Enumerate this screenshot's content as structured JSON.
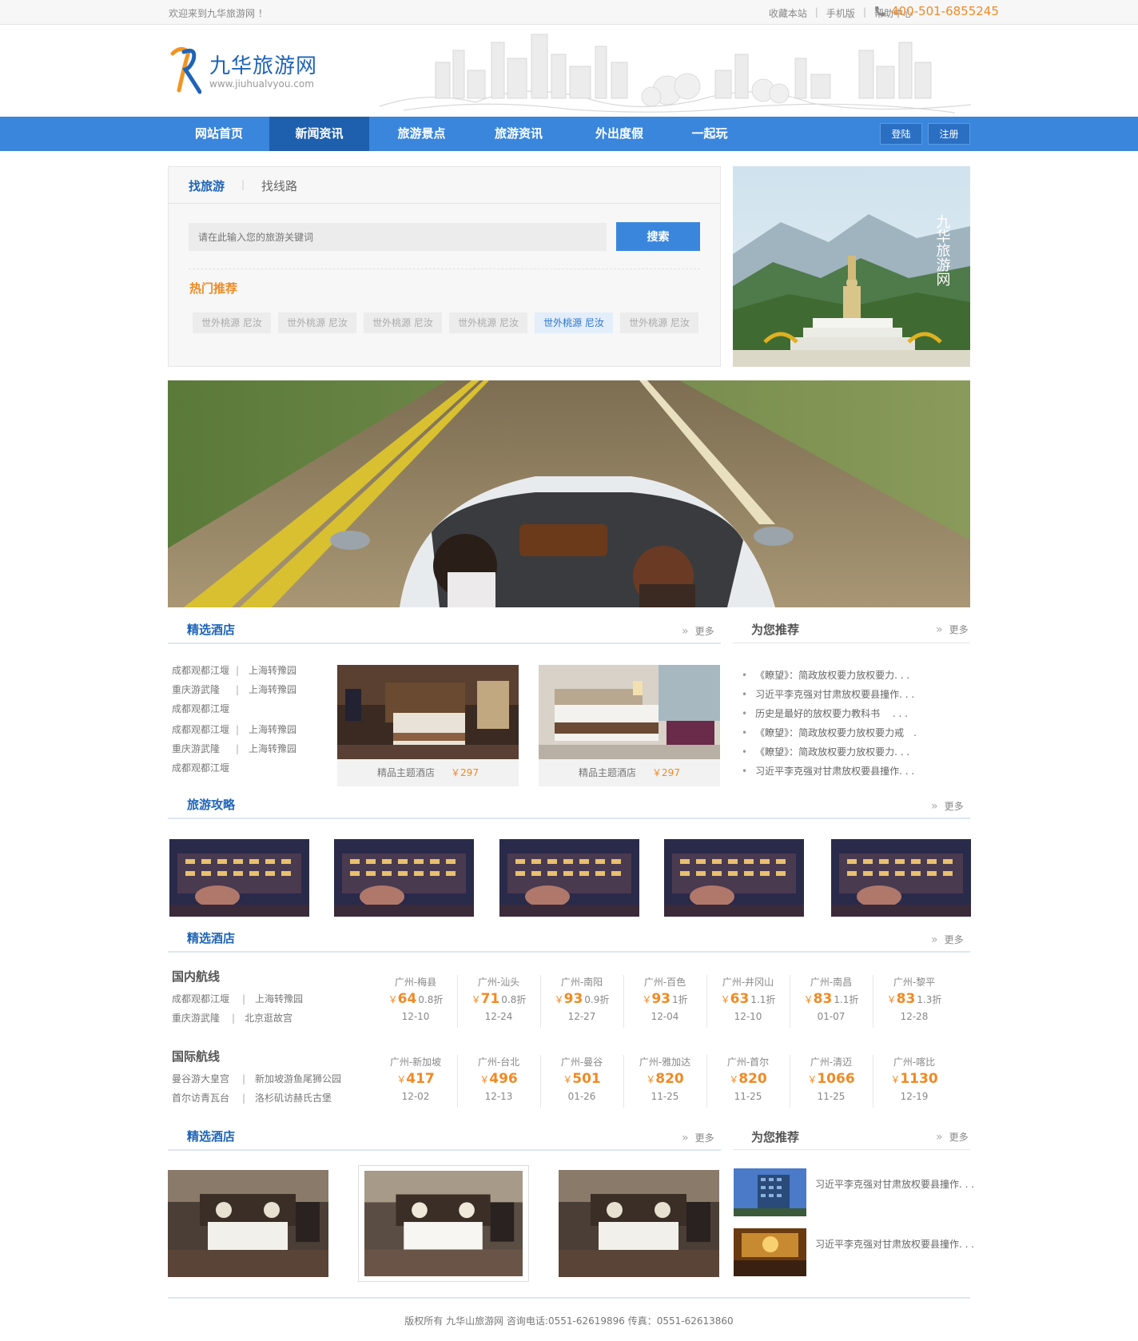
{
  "topbar": {
    "welcome": "欢迎来到九华旅游网 ！",
    "links": [
      "收藏本站",
      "手机版",
      "帮助中心"
    ],
    "phone": "400-501-6855245"
  },
  "logo": {
    "title": "九华旅游网",
    "url": "www.jiuhualvyou.com"
  },
  "nav": {
    "items": [
      "网站首页",
      "新闻资讯",
      "旅游景点",
      "旅游资讯",
      "外出度假",
      "一起玩"
    ],
    "active_index": 1,
    "login": "登陆",
    "register": "注册"
  },
  "search": {
    "tab_active": "找旅游",
    "tab_other": "找线路",
    "placeholder": "请在此输入您的旅游关键词",
    "button": "搜索",
    "hot_title": "热门推荐",
    "hot_tags": [
      "世外桃源 尼汝",
      "世外桃源 尼汝",
      "世外桃源 尼汝",
      "世外桃源 尼汝",
      "世外桃源 尼汝",
      "世外桃源 尼汝"
    ],
    "hot_active_index": 4
  },
  "side_photo": {
    "calligraphy": "九华旅游网"
  },
  "hotels": {
    "title": "精选酒店",
    "more": "更多",
    "list": [
      [
        "成都观都江堰",
        "上海转豫园"
      ],
      [
        "重庆游武隆",
        "上海转豫园"
      ],
      [
        "成都观都江堰",
        ""
      ],
      [
        "成都观都江堰",
        "上海转豫园"
      ],
      [
        "重庆游武隆",
        "上海转豫园"
      ],
      [
        "成都观都江堰",
        ""
      ]
    ],
    "cards": [
      {
        "name": "精品主题酒店",
        "price": "￥297"
      },
      {
        "name": "精品主题酒店",
        "price": "￥297"
      }
    ]
  },
  "recommend": {
    "title": "为您推荐",
    "more": "更多",
    "items": [
      "《瞭望》：简政放权要力放权要力. . .",
      "习近平李克强对甘肃放权要县撞作. . .",
      "历史是最好的放权要力教科书　 . . .",
      "《瞭望》：简政放权要力放权要力戒　.",
      "《瞭望》：简政放权要力放权要力. . .",
      "习近平李克强对甘肃放权要县撞作. . ."
    ]
  },
  "strategy": {
    "title": "旅游攻略",
    "more": "更多"
  },
  "routes": {
    "title": "精选酒店",
    "more": "更多",
    "domestic": {
      "title": "国内航线",
      "links": [
        [
          "成都观都江堰",
          "上海转豫园"
        ],
        [
          "重庆游武隆",
          "北京逛故宫"
        ]
      ],
      "items": [
        {
          "city": "广州-梅县",
          "price": "64",
          "disc": "0.8折",
          "date": "12-10"
        },
        {
          "city": "广州-汕头",
          "price": "71",
          "disc": "0.8折",
          "date": "12-24"
        },
        {
          "city": "广州-南阳",
          "price": "93",
          "disc": "0.9折",
          "date": "12-27"
        },
        {
          "city": "广州-百色",
          "price": "93",
          "disc": "1折",
          "date": "12-04"
        },
        {
          "city": "广州-井冈山",
          "price": "63",
          "disc": "1.1折",
          "date": "12-10"
        },
        {
          "city": "广州-南昌",
          "price": "83",
          "disc": "1.1折",
          "date": "01-07"
        },
        {
          "city": "广州-黎平",
          "price": "83",
          "disc": "1.3折",
          "date": "12-28"
        }
      ]
    },
    "international": {
      "title": "国际航线",
      "links": [
        [
          "曼谷游大皇宫",
          "新加坡游鱼尾狮公园"
        ],
        [
          "首尔访青瓦台",
          "洛杉矶访赫氏古堡"
        ]
      ],
      "items": [
        {
          "city": "广州-新加坡",
          "price": "417",
          "date": "12-02"
        },
        {
          "city": "广州-台北",
          "price": "496",
          "date": "12-13"
        },
        {
          "city": "广州-曼谷",
          "price": "501",
          "date": "01-26"
        },
        {
          "city": "广州-雅加达",
          "price": "820",
          "date": "11-25"
        },
        {
          "city": "广州-首尔",
          "price": "820",
          "date": "11-25"
        },
        {
          "city": "广州-清迈",
          "price": "1066",
          "date": "11-25"
        },
        {
          "city": "广州-喀比",
          "price": "1130",
          "date": "12-19"
        }
      ]
    },
    "currency": "￥"
  },
  "hotels2": {
    "title": "精选酒店",
    "more": "更多"
  },
  "recommend2": {
    "title": "为您推荐",
    "more": "更多",
    "items": [
      "习近平李克强对甘肃放权要县撞作. . .",
      "习近平李克强对甘肃放权要县撞作. . ."
    ]
  },
  "footer": {
    "text": "版权所有  九华山旅游网   咨询电话:0551-62619896  传真：0551-62613860"
  },
  "colors": {
    "nav_bg": "#3a86dc",
    "nav_active": "#1e5fae",
    "accent_orange": "#f08a24",
    "title_blue": "#1e64b8"
  }
}
